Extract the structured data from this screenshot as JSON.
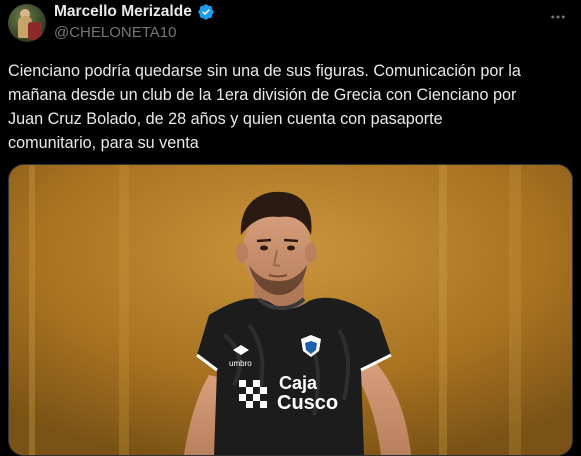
{
  "author": {
    "display_name": "Marcello Merizalde",
    "handle": "@CHELONETA10",
    "verified": true,
    "icons": {
      "verified": "verified-badge-icon",
      "more": "more-options-icon",
      "avatar": "profile-avatar"
    }
  },
  "tweet": {
    "lines": [
      "Cienciano podría quedarse sin una de sus figuras. Comunicación por la",
      "mañana desde un club de la 1era división de Grecia con Cienciano por",
      "Juan Cruz Bolado, de 28 años y quien cuenta con pasaporte",
      "comunitario, para su venta"
    ]
  },
  "media": {
    "jersey_sponsor_line1": "Caja",
    "jersey_sponsor_line2": "Cusco",
    "jersey_brand": "umbro"
  },
  "colors": {
    "background": "#000000",
    "text_primary": "#e7e9ea",
    "text_secondary": "#71767b",
    "verified_blue": "#1d9bf0",
    "media_border": "#2f3336",
    "photo_background": "#b8842e",
    "jersey": "#1a1a1a"
  }
}
